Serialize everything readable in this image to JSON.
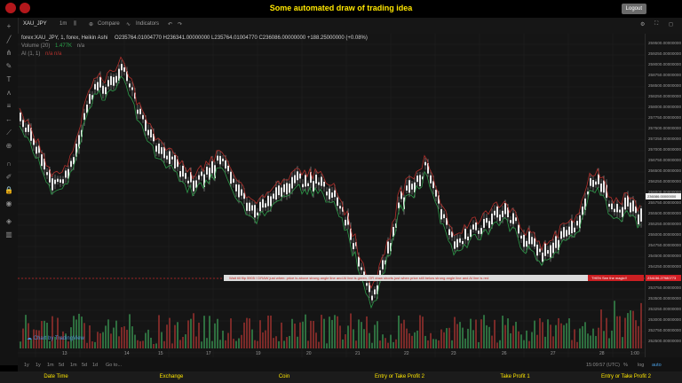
{
  "header": {
    "title": "Some automated draw of trading idea",
    "logout_label": "Logout"
  },
  "toolbar": {
    "symbol": "XAU_JPY",
    "interval": "1m",
    "compare_label": "Compare",
    "indicators_label": "Indicators"
  },
  "legend": {
    "line1": "forex:XAU_JPY, 1, forex, Heikin Ashi",
    "ohlc": "O235764.01004770  H236341.00000000  L235764.01004770  C236086.00000000  +188.25000000 (+0.08%)",
    "volume": "Volume (20)",
    "volume_val": "1.477K",
    "volume_na": "n/a",
    "ai": "AI (1, 1)",
    "ai_na": "n/a  n/a"
  },
  "price_axis": {
    "ticks": [
      "259500.00000000",
      "259250.00000000",
      "259000.00000000",
      "258750.00000000",
      "258500.00000000",
      "258250.00000000",
      "258000.00000000",
      "257750.00000000",
      "257500.00000000",
      "257250.00000000",
      "257000.00000000",
      "256750.00000000",
      "256500.00000000",
      "256250.00000000",
      "256000.00000000",
      "255750.00000000",
      "255500.00000000",
      "255250.00000000",
      "255000.00000000",
      "254750.00000000",
      "254500.00000000",
      "254250.00000000",
      "254000.00000000",
      "253750.00000000",
      "253500.00000000",
      "253250.00000000",
      "253000.00000000",
      "252750.00000000",
      "252500.00000000"
    ],
    "current_label": "236086.00000000",
    "marker_label": "234156.27980773"
  },
  "time_axis": {
    "ticks": [
      "13",
      "14",
      "15",
      "17",
      "19",
      "20",
      "21",
      "22",
      "23",
      "26",
      "27",
      "28",
      "1:00"
    ]
  },
  "annotation": {
    "text": "Wait till flip 5905 !    DRAW just when: price is above strong angle line and AI line is green.      OR      draw shorts just when price still below strong angle line and AI line is red",
    "red_text": "THEN See the magic!!"
  },
  "bottom": {
    "ranges": [
      "1y",
      "1y",
      "1m",
      "5d",
      "1m",
      "5d",
      "1d",
      "Go to..."
    ],
    "clock": "15:09:57 (UTC)",
    "percent": "%",
    "log": "log",
    "auto": "auto"
  },
  "watermark": "Chart by TradingView",
  "footer": {
    "labels": [
      "Date Time",
      "Exchange",
      "Coin",
      "Entry or Take Profit 2",
      "Take Profit 1",
      "Entry or Take Profit 2"
    ]
  },
  "colors": {
    "accent": "#ffe700",
    "bull": "#2e9b4a",
    "bear": "#b3302c",
    "candle": "#e6e6e6"
  }
}
